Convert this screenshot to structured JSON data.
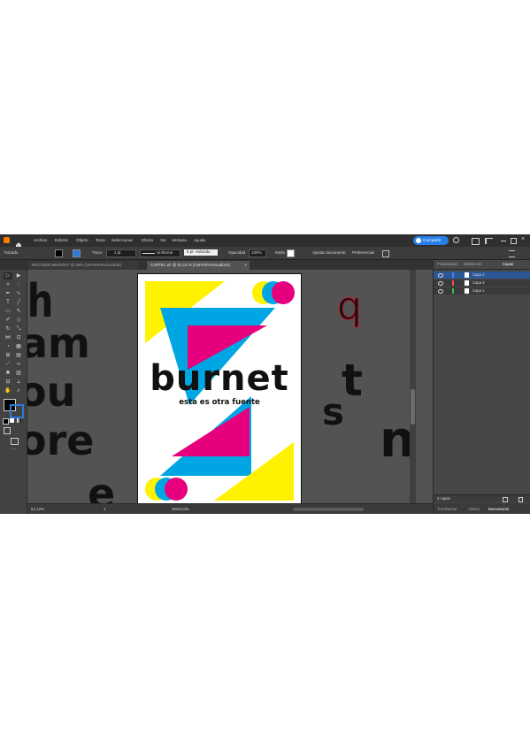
{
  "menu": [
    "Archivo",
    "Edición",
    "Objeto",
    "Texto",
    "Seleccionar",
    "Efecto",
    "Ver",
    "Ventana",
    "Ayuda"
  ],
  "share_label": "Compartir",
  "control": {
    "object_type": "Trazado",
    "stroke_label": "Trazo",
    "stroke_value": "1 pt",
    "stroke_style": "Uniforme",
    "brush": "5 pt. redondo",
    "opacity_label": "Opacidad",
    "opacity_value": "100%",
    "style_label": "Estilo",
    "doc_setup": "Ajustar documento",
    "prefs": "Preferencias"
  },
  "tabs": [
    {
      "label": "RECONOCIMIENTO* @ 25% (CMYK/Previsualizar)",
      "active": false
    },
    {
      "label": "CARTEL.ai* @ 51,12 % (CMYK/Previsualizar)",
      "active": true
    }
  ],
  "artboard": {
    "title": "burnet",
    "subtitle": "esta es otra fuente",
    "colors": {
      "yellow": "#fff200",
      "cyan": "#00a6e4",
      "magenta": "#e6007e"
    }
  },
  "letters_left": [
    "h",
    "am",
    "ou",
    "ore",
    "e"
  ],
  "letters_right": [
    "q",
    "t",
    "s",
    "n"
  ],
  "panel": {
    "tabs": [
      "Propiedades",
      "Bibliotecas",
      "Capas"
    ],
    "layers": [
      "Capa 2",
      "Capa 3",
      "Capa 1"
    ],
    "layer_colors": [
      "#4e7bff",
      "#ff4e4e",
      "#2fbf4e"
    ],
    "layer_count": "3 capas",
    "bottom_tabs": [
      "Transformar",
      "Alinear",
      "Buscatrazos"
    ]
  },
  "status": {
    "zoom": "51,12%",
    "page": "1",
    "tool": "Selección"
  }
}
